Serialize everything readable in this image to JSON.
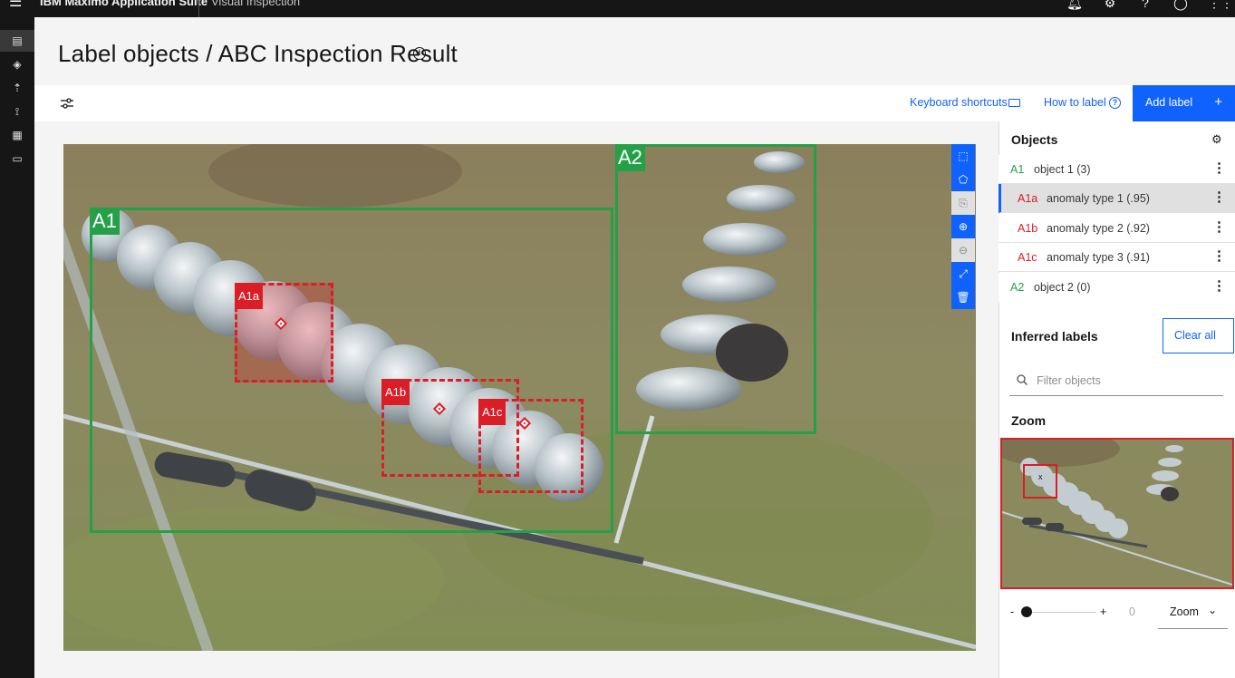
{
  "header": {
    "brand": "IBM Maximo Application Suite",
    "product": "Visual Inspection",
    "icons": [
      "notification-icon",
      "settings-icon",
      "help-icon",
      "user-icon",
      "app-switcher-icon"
    ]
  },
  "leftnav": {
    "icons": [
      "datasets-icon",
      "models-icon",
      "deploy-icon",
      "workflow-icon",
      "projects-icon",
      "toolkit-icon"
    ]
  },
  "page": {
    "title": "Label objects / ABC Inspection Result"
  },
  "toolbar": {
    "keyboard_shortcuts": "Keyboard shortcuts",
    "how_to_label": "How to label",
    "add_label": "Add label",
    "add_plus": "+"
  },
  "annotations": [
    {
      "id": "A1",
      "kind": "object"
    },
    {
      "id": "A2",
      "kind": "object"
    },
    {
      "id": "A1a",
      "kind": "anomaly"
    },
    {
      "id": "A1b",
      "kind": "anomaly"
    },
    {
      "id": "A1c",
      "kind": "anomaly"
    }
  ],
  "objects_panel": {
    "title": "Objects",
    "items": [
      {
        "code": "A1",
        "label": "object 1 (3)",
        "color": "green",
        "selected": false
      },
      {
        "code": "A1a",
        "label": "anomaly type 1 (.95)",
        "color": "red",
        "selected": true
      },
      {
        "code": "A1b",
        "label": "anomaly type 2 (.92)",
        "color": "red",
        "selected": false
      },
      {
        "code": "A1c",
        "label": "anomaly type 3 (.91)",
        "color": "red",
        "selected": false
      },
      {
        "code": "A2",
        "label": "object 2 (0)",
        "color": "green",
        "selected": false
      }
    ]
  },
  "inferred": {
    "title": "Inferred labels",
    "clear_all": "Clear all",
    "filter_placeholder": "Filter objects"
  },
  "zoom": {
    "title": "Zoom",
    "minus": "-",
    "plus": "+",
    "value": "0",
    "select_label": "Zoom",
    "slider_level": 0
  },
  "colors": {
    "object": "#24a148",
    "anomaly": "#da1e28",
    "primary": "#0f62fe"
  }
}
